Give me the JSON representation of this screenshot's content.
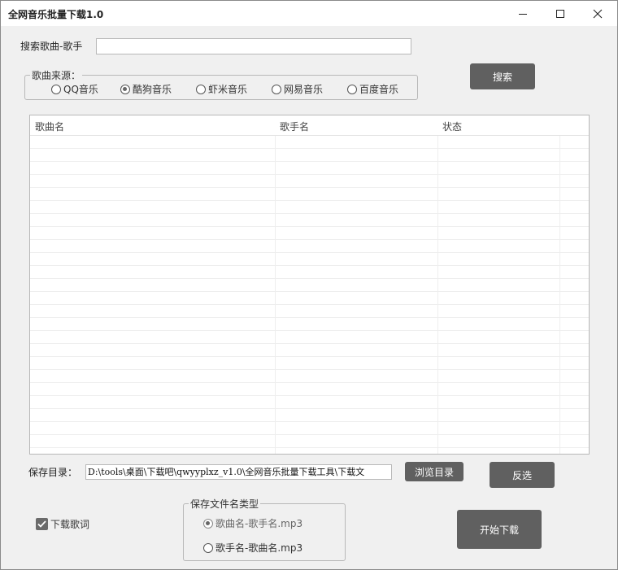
{
  "window": {
    "title": "全网音乐批量下载1.0"
  },
  "search": {
    "label": "搜索歌曲-歌手",
    "value": "",
    "button": "搜索"
  },
  "source": {
    "legend": "歌曲来源：",
    "options": [
      {
        "label": "QQ音乐",
        "checked": false
      },
      {
        "label": "酷狗音乐",
        "checked": true
      },
      {
        "label": "虾米音乐",
        "checked": false
      },
      {
        "label": "网易音乐",
        "checked": false
      },
      {
        "label": "百度音乐",
        "checked": false
      }
    ]
  },
  "table": {
    "columns": [
      "歌曲名",
      "歌手名",
      "状态"
    ],
    "rows": []
  },
  "save": {
    "label": "保存目录：",
    "path": "D:\\tools\\桌面\\下载吧\\qwyyplxz_v1.0\\全网音乐批量下载工具\\下载文",
    "browse_button": "浏览目录",
    "invert_button": "反选"
  },
  "lyrics": {
    "label": "下载歌词",
    "checked": true
  },
  "filename": {
    "legend": "保存文件名类型",
    "options": [
      {
        "label": "歌曲名-歌手名.mp3",
        "checked": true
      },
      {
        "label": "歌手名-歌曲名.mp3",
        "checked": false
      }
    ]
  },
  "start_button": "开始下载",
  "icons": [
    "minimize-icon",
    "maximize-icon",
    "close-icon",
    "check-icon"
  ]
}
